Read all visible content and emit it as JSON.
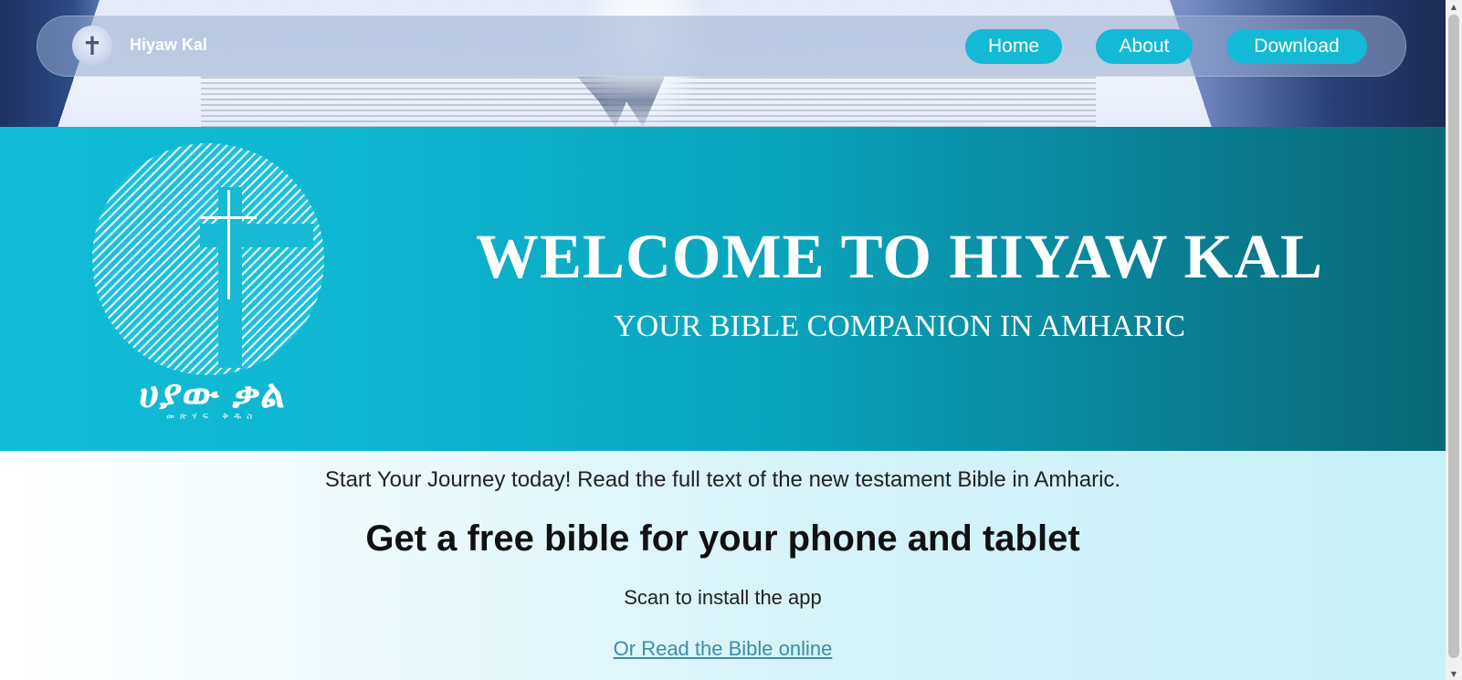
{
  "navbar": {
    "brand": "Hiyaw Kal",
    "links": [
      {
        "label": "Home"
      },
      {
        "label": "About"
      },
      {
        "label": "Download"
      }
    ],
    "logo_glyph": "✝"
  },
  "banner": {
    "logo_text": "ሀያው ቃል",
    "logo_subtext": "መጽሃፍ ቅዱስ",
    "title": "WELCOME TO HIYAW KAL",
    "tagline": "YOUR BIBLE COMPANION IN AMHARIC"
  },
  "content": {
    "intro": "Start Your Journey today! Read the full text of the new testament Bible in Amharic.",
    "headline": "Get a free bible for your phone and tablet",
    "scan_text": "Scan to install the app",
    "online_link": "Or Read the Bible online"
  },
  "scrollbar": {
    "up_icon": "▲",
    "down_icon": "▼"
  },
  "colors": {
    "accent": "#14b9d6",
    "banner_start": "#11bcd6",
    "banner_end": "#0a6877",
    "link": "#3a8ea8"
  }
}
